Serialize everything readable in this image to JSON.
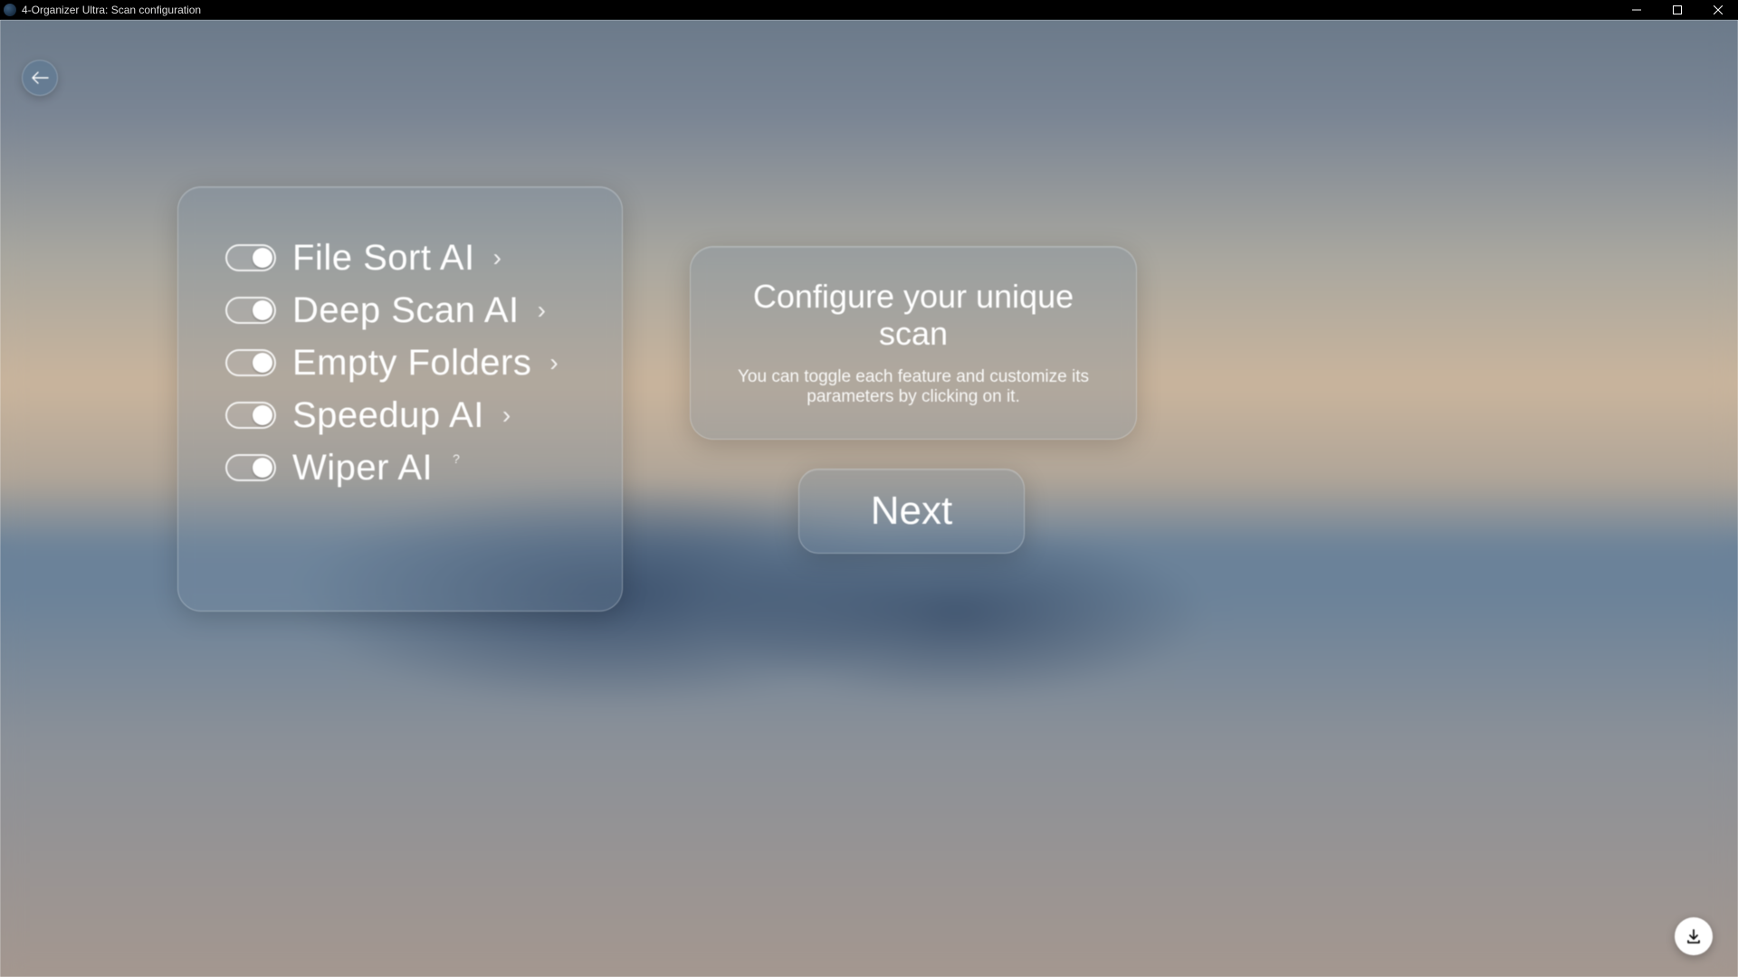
{
  "window": {
    "title": "4-Organizer Ultra: Scan configuration"
  },
  "back": {
    "icon": "arrow-left"
  },
  "features": [
    {
      "label": "File Sort AI",
      "marker": "chevron",
      "enabled": true
    },
    {
      "label": "Deep Scan AI",
      "marker": "chevron",
      "enabled": true
    },
    {
      "label": "Empty Folders",
      "marker": "chevron",
      "enabled": true
    },
    {
      "label": "Speedup AI",
      "marker": "chevron",
      "enabled": true
    },
    {
      "label": "Wiper AI",
      "marker": "question",
      "enabled": true
    }
  ],
  "info": {
    "title": "Configure your unique scan",
    "subtitle": "You can toggle each feature and customize its parameters by clicking on it."
  },
  "next": {
    "label": "Next"
  },
  "fab": {
    "icon": "download"
  }
}
